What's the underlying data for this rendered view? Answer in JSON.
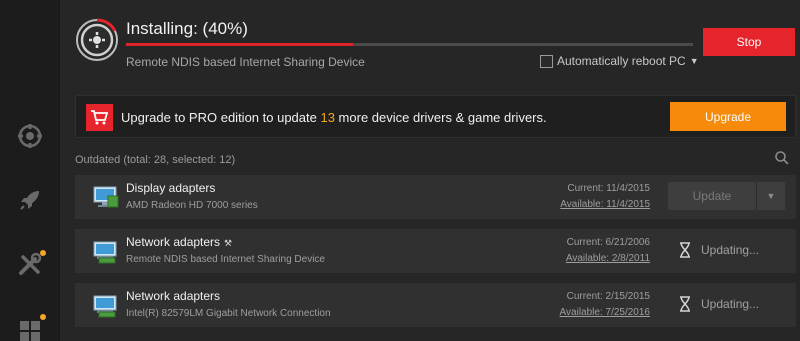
{
  "status": {
    "title": "Installing: (40%)",
    "progress_percent": 40,
    "device": "Remote NDIS based Internet Sharing Device",
    "reboot_label": "Automatically reboot PC",
    "reboot_checked": false,
    "stop_label": "Stop"
  },
  "sidebar": {
    "items": [
      {
        "icon": "target-icon"
      },
      {
        "icon": "rocket-icon"
      },
      {
        "icon": "tools-icon",
        "badge": true
      },
      {
        "icon": "grid-icon",
        "badge": true
      }
    ]
  },
  "promo": {
    "text_before": "Upgrade to PRO edition to update ",
    "count": "13",
    "text_after": " more device drivers & game drivers.",
    "button_label": "Upgrade"
  },
  "list": {
    "summary": "Outdated (total: 28, selected: 12)"
  },
  "devices": [
    {
      "name": "Display adapters",
      "sub": "AMD Radeon HD 7000 series",
      "current": "Current: 11/4/2015",
      "available": "Available: 11/4/2015",
      "action": "Update",
      "badge": ""
    },
    {
      "name": "Network adapters",
      "sub": "Remote NDIS based Internet Sharing Device",
      "current": "Current: 6/21/2006",
      "available": "Available: 2/8/2011",
      "action": "Updating...",
      "badge": "⚒"
    },
    {
      "name": "Network adapters",
      "sub": "Intel(R) 82579LM Gigabit Network Connection",
      "current": "Current: 2/15/2015",
      "available": "Available: 7/25/2016",
      "action": "Updating...",
      "badge": ""
    }
  ],
  "colors": {
    "accent_red": "#e5242c",
    "accent_orange": "#f58a0b",
    "highlight": "#f5a623"
  }
}
